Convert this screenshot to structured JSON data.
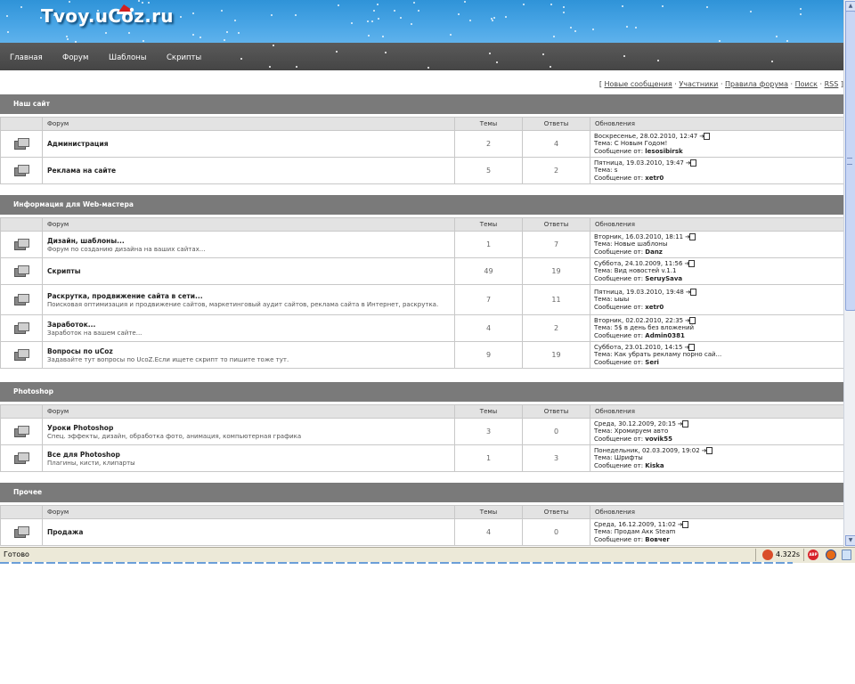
{
  "header": {
    "logo_text": "Tvoy.uCoz.ru",
    "nav": [
      "Главная",
      "Форум",
      "Шаблоны",
      "Скрипты"
    ]
  },
  "toplinks": {
    "open_bracket": "[",
    "close_bracket": "]",
    "sep": "·",
    "items": [
      "Новые сообщения",
      "Участники",
      "Правила форума",
      "Поиск",
      "RSS"
    ]
  },
  "columns": {
    "forum": "Форум",
    "topics": "Темы",
    "replies": "Ответы",
    "updates": "Обновления"
  },
  "labels": {
    "topic": "Тема:",
    "from": "Сообщение от:"
  },
  "categories": [
    {
      "title": "Наш сайт",
      "forums": [
        {
          "name": "Администрация",
          "desc": "",
          "topics": "2",
          "replies": "4",
          "date": "Воскресенье, 28.02.2010, 12:47",
          "topic": "С Новым Годом!",
          "author": "lesosibirsk"
        },
        {
          "name": "Реклама на сайте",
          "desc": "",
          "topics": "5",
          "replies": "2",
          "date": "Пятница, 19.03.2010, 19:47",
          "topic": "s",
          "author": "xetr0"
        }
      ]
    },
    {
      "title": "Информация для Web-мастера",
      "forums": [
        {
          "name": "Дизайн, шаблоны...",
          "desc": "Форум по созданию дизайна на ваших сайтах...",
          "topics": "1",
          "replies": "7",
          "date": "Вторник, 16.03.2010, 18:11",
          "topic": "Новые шаблоны",
          "author": "Danz"
        },
        {
          "name": "Скрипты",
          "desc": "",
          "topics": "49",
          "replies": "19",
          "date": "Суббота, 24.10.2009, 11:56",
          "topic": "Вид новостей v.1.1",
          "author": "SeruySava"
        },
        {
          "name": "Раскрутка, продвижение сайта в сети...",
          "desc": "Поисковая оптимизация и продвижение сайтов, маркетинговый аудит сайтов, реклама сайта в Интернет, раскрутка.",
          "topics": "7",
          "replies": "11",
          "date": "Пятница, 19.03.2010, 19:48",
          "topic": "ыыы",
          "author": "xetr0"
        },
        {
          "name": "Заработок...",
          "desc": "Заработок на вашем сайте...",
          "topics": "4",
          "replies": "2",
          "date": "Вторник, 02.02.2010, 22:35",
          "topic": "5$ в день без вложений",
          "author": "Admin0381"
        },
        {
          "name": "Вопросы по uCoz",
          "desc": "Задавайте тут вопросы по UcoZ.Если ищете скрипт то пишите тоже тут.",
          "topics": "9",
          "replies": "19",
          "date": "Суббота, 23.01.2010, 14:15",
          "topic": "Как убрать рекламу порно сай...",
          "author": "Seri"
        }
      ]
    },
    {
      "title": "Photoshop",
      "forums": [
        {
          "name": "Уроки Photoshop",
          "desc": "Спец. эффекты, дизайн, обработка фото, анимация, компьютерная графика",
          "topics": "3",
          "replies": "0",
          "date": "Среда, 30.12.2009, 20:15",
          "topic": "Хромируем авто",
          "author": "vovik55"
        },
        {
          "name": "Все для Photoshop",
          "desc": "Плагины, кисти, клипарты",
          "topics": "1",
          "replies": "3",
          "date": "Понедельник, 02.03.2009, 19:02",
          "topic": "Шрифты",
          "author": "Kiska"
        }
      ]
    },
    {
      "title": "Прочее",
      "forums": [
        {
          "name": "Продажа",
          "desc": "",
          "topics": "4",
          "replies": "0",
          "date": "Среда, 16.12.2009, 11:02",
          "topic": "Продам Акк Steam",
          "author": "Bовчег"
        }
      ]
    }
  ],
  "statusbar": {
    "status": "Готово",
    "load_time": "4.322s",
    "abp_label": "ABP"
  }
}
